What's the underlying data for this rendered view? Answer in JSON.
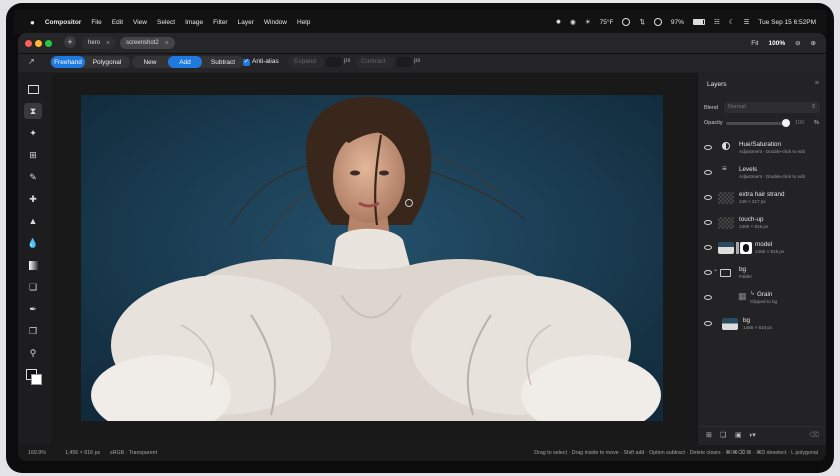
{
  "menubar": {
    "app_name": "Compositor",
    "menus": [
      "File",
      "Edit",
      "View",
      "Select",
      "Image",
      "Filter",
      "Layer",
      "Window",
      "Help"
    ],
    "weather": "75°F",
    "battery": "97%",
    "clock": "Tue Sep 15  6:52PM"
  },
  "window": {
    "tabs": [
      {
        "label": "hero",
        "active": false
      },
      {
        "label": "screenshot2",
        "active": true
      }
    ],
    "fit_label": "Fit",
    "zoom": "100%"
  },
  "options": {
    "freehand": "Freehand",
    "polygonal": "Polygonal",
    "new": "New",
    "add": "Add",
    "subtract": "Subtract",
    "antialias": "Anti-alias",
    "expand": "Expand",
    "contract": "Contract",
    "px": "px"
  },
  "tools": [
    "marquee-icon",
    "lasso-icon",
    "magic-wand-icon",
    "crop-icon",
    "brush-icon",
    "healing-icon",
    "stamp-icon",
    "blur-icon",
    "gradient-icon",
    "shape-icon",
    "eyedropper-icon",
    "clone-icon",
    "zoom-icon",
    "color-swatch-icon"
  ],
  "layers_panel": {
    "title": "Layers",
    "blend_label": "Blend",
    "blend_value": "Normal",
    "opacity_label": "Opacity",
    "opacity_value": "100",
    "opacity_unit": "%",
    "layers": [
      {
        "name": "Hue/Saturation",
        "sub": "Adjustment · Double-click to edit"
      },
      {
        "name": "Levels",
        "sub": "Adjustment · Double-click to edit"
      },
      {
        "name": "extra hair strand",
        "sub": "148 × 317 px"
      },
      {
        "name": "touch-up",
        "sub": "1456 × 816 px"
      },
      {
        "name": "model",
        "sub": "1456 × 816 px"
      },
      {
        "name": "bg",
        "sub": "Folder"
      },
      {
        "name": "Grain",
        "sub": "Clipped to bg"
      },
      {
        "name": "bg",
        "sub": "1456 × 816 px"
      }
    ]
  },
  "status": {
    "zoom": "169.9%",
    "dimensions": "1,456 × 816 px",
    "color": "sRGB · Transparent",
    "hint": "Drag to select · Drag inside to move · Shift add · Option subtract · Delete clears · ⌘/⌘⌫ fill · ⌘D deselect · L polygonal"
  },
  "colors": {
    "accent": "#1f7ae0"
  }
}
